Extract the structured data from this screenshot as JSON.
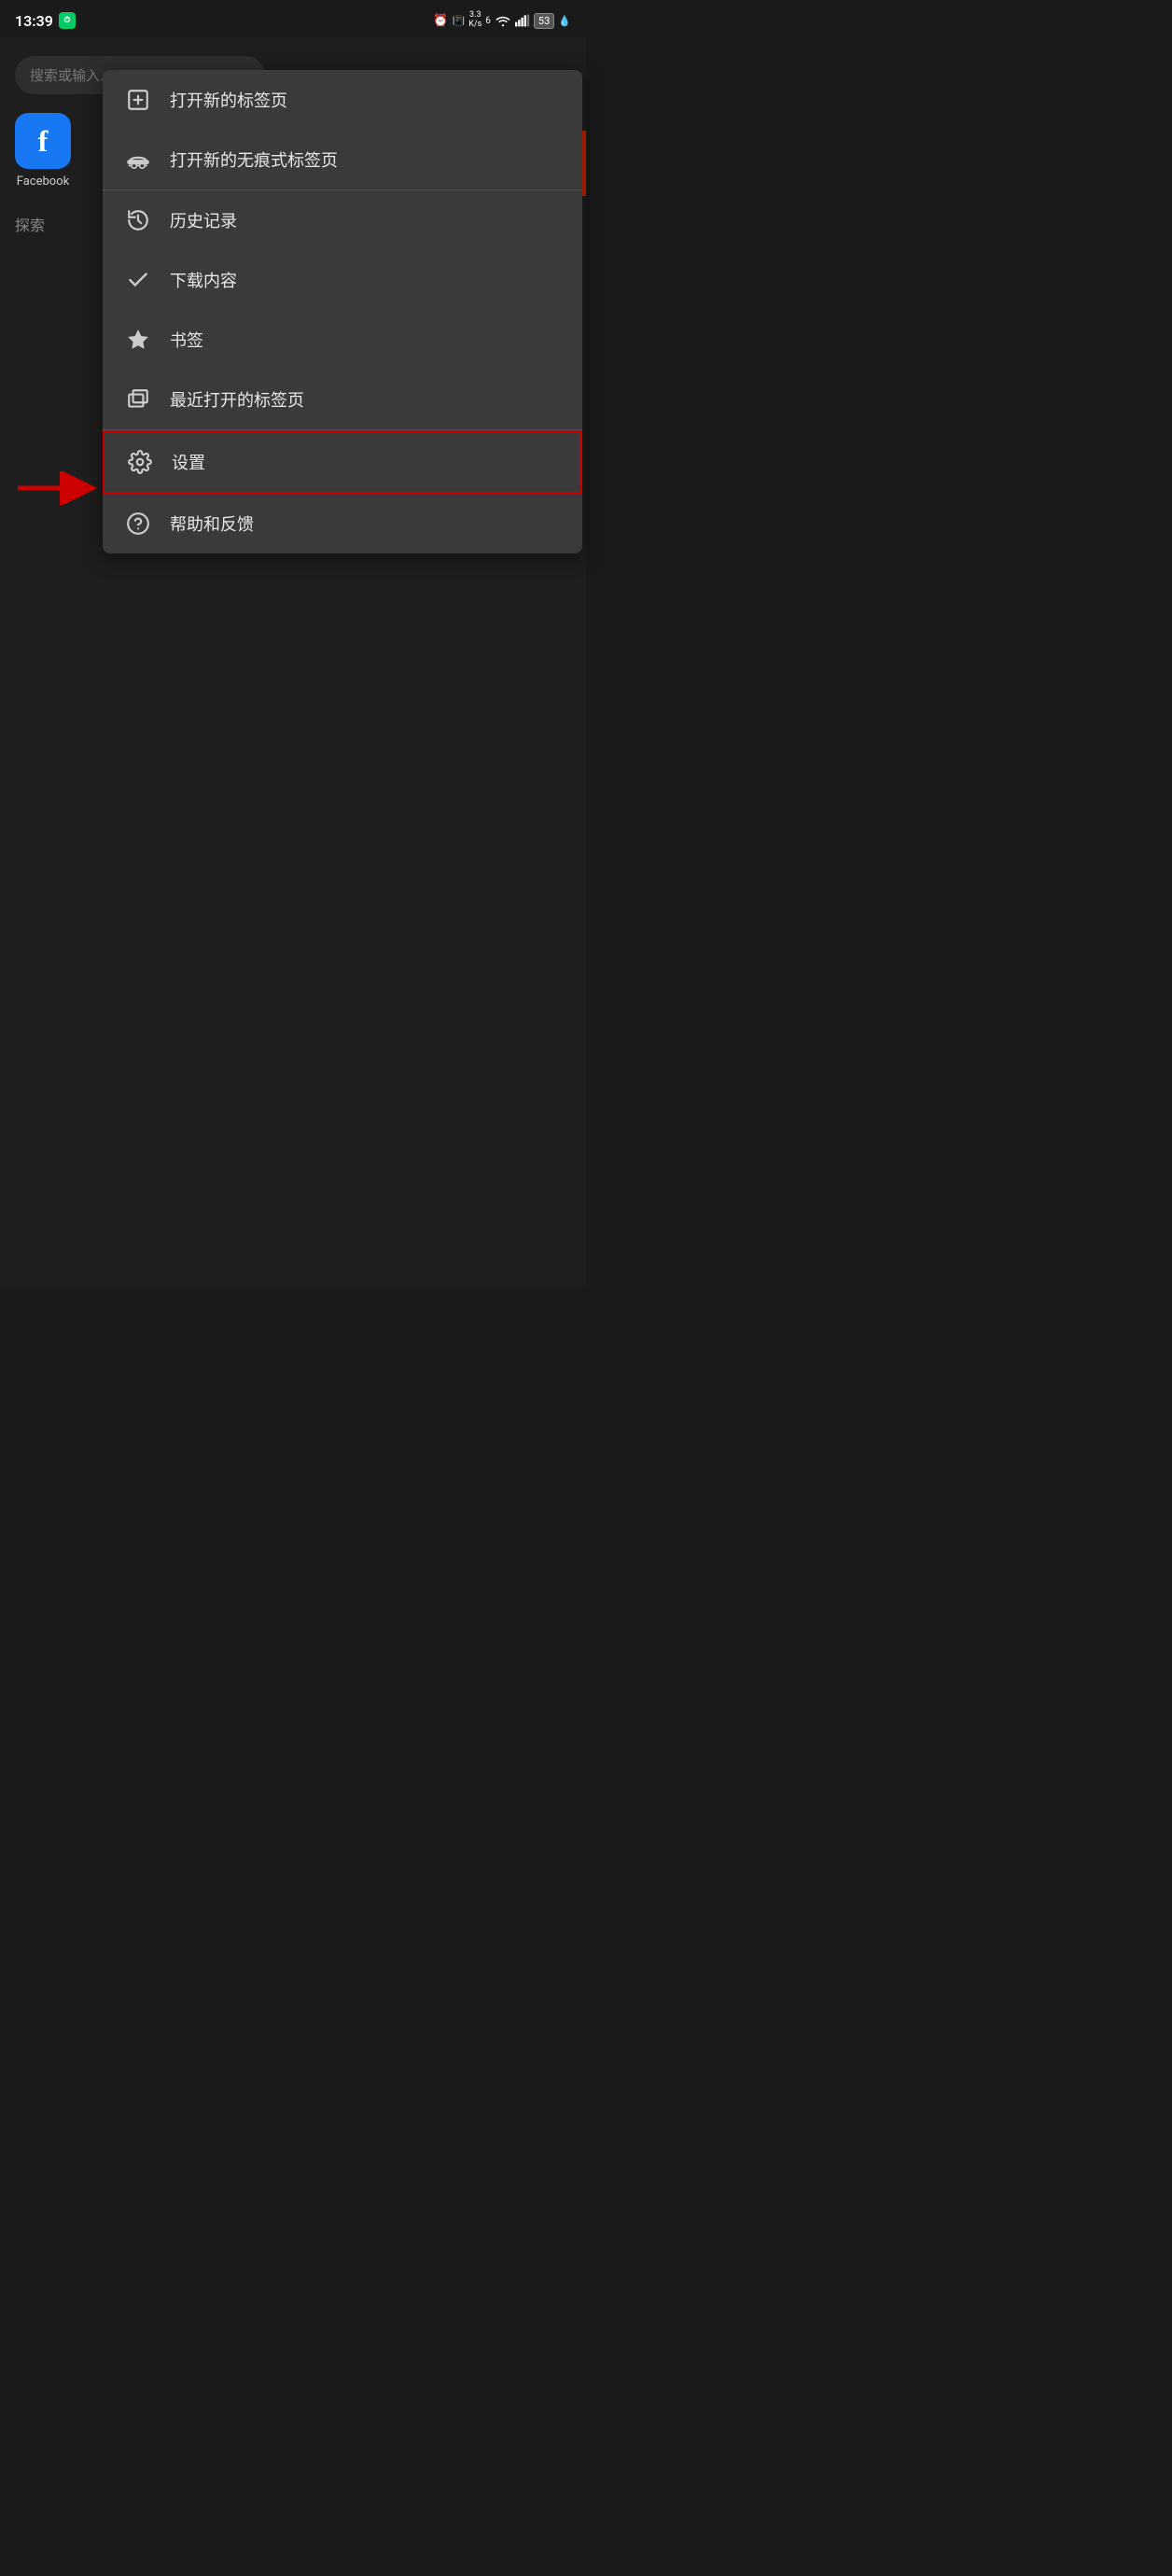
{
  "statusBar": {
    "time": "13:39",
    "timerIcon": "⏱",
    "alarmIcon": "⏰",
    "vibrate": "⚡",
    "network": "3.3\nK/s",
    "wifi": "wifi",
    "signal": "signal",
    "battery": "53",
    "batteryDrop": "🔵"
  },
  "browser": {
    "searchPlaceholder": "搜索或输入...",
    "facebookLabel": "Facebook",
    "exploreLabel": "探索"
  },
  "menu": {
    "items": [
      {
        "id": "new-tab",
        "label": "打开新的标签页",
        "icon": "new-tab-icon"
      },
      {
        "id": "incognito",
        "label": "打开新的无痕式标签页",
        "icon": "incognito-icon"
      },
      {
        "id": "history",
        "label": "历史记录",
        "icon": "history-icon"
      },
      {
        "id": "downloads",
        "label": "下载内容",
        "icon": "downloads-icon"
      },
      {
        "id": "bookmarks",
        "label": "书签",
        "icon": "bookmarks-icon"
      },
      {
        "id": "recent-tabs",
        "label": "最近打开的标签页",
        "icon": "recent-tabs-icon"
      },
      {
        "id": "settings",
        "label": "设置",
        "icon": "settings-icon",
        "highlighted": true
      },
      {
        "id": "help",
        "label": "帮助和反馈",
        "icon": "help-icon"
      }
    ],
    "arrowText": "→"
  }
}
